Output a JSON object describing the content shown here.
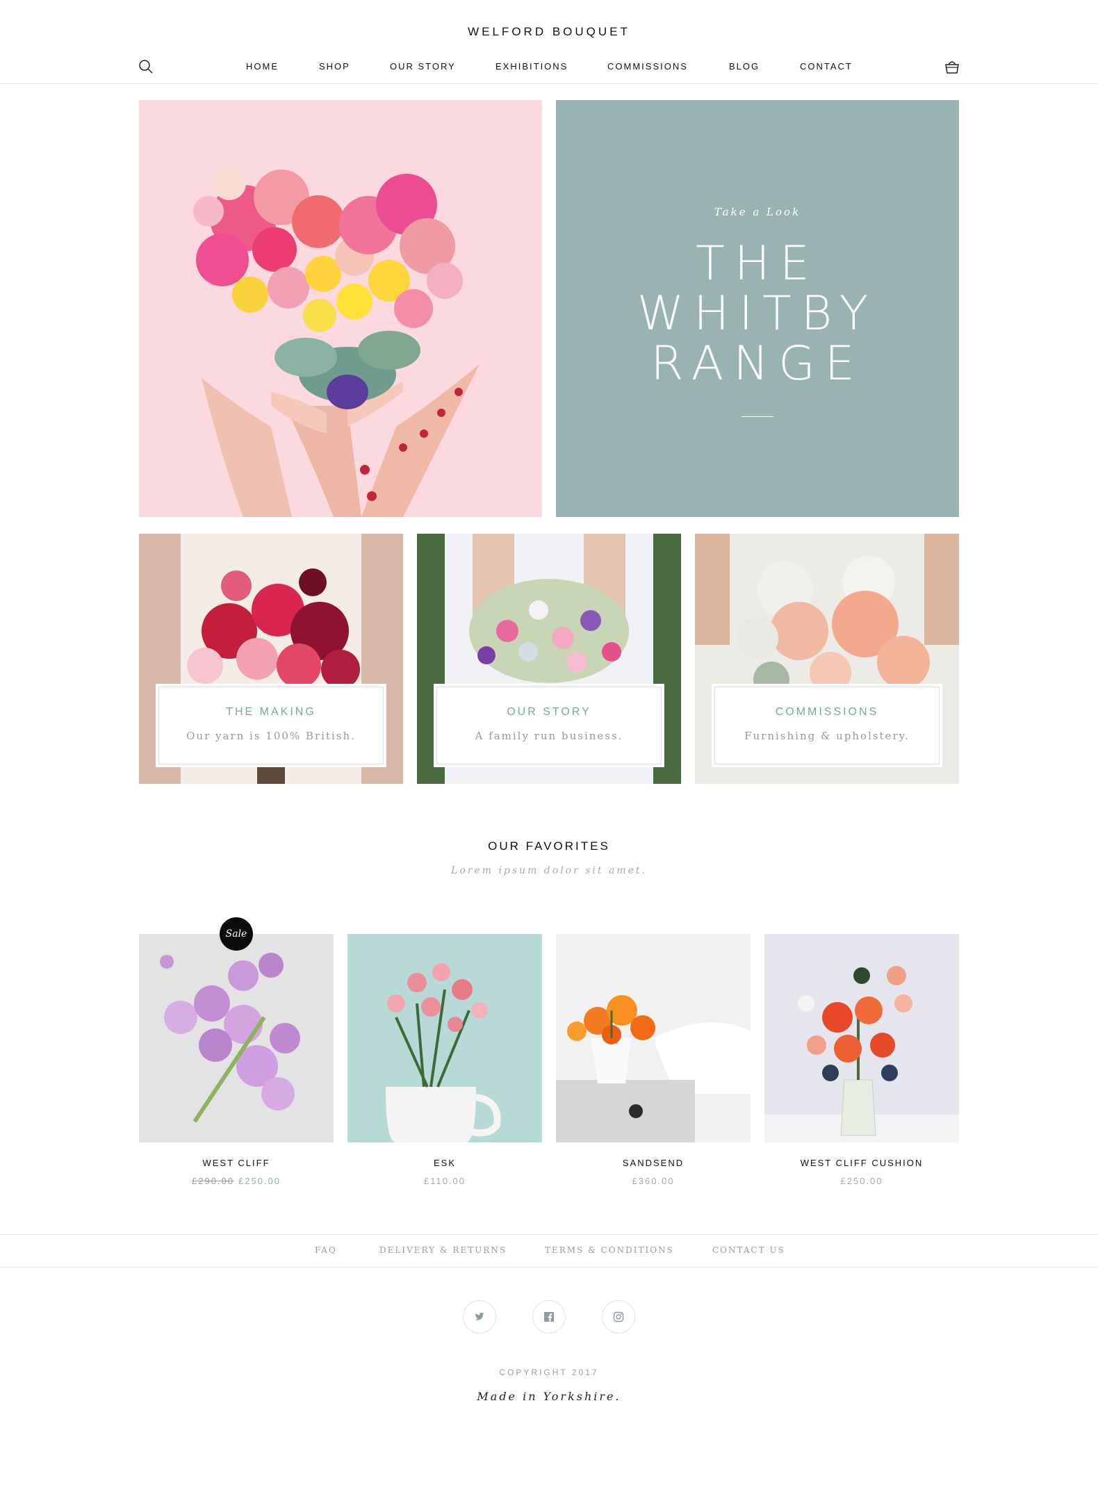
{
  "header": {
    "brand": "WELFORD BOUQUET",
    "search_icon": "search-icon",
    "cart_icon": "basket-icon",
    "nav": [
      {
        "label": "HOME"
      },
      {
        "label": "SHOP"
      },
      {
        "label": "OUR STORY"
      },
      {
        "label": "EXHIBITIONS"
      },
      {
        "label": "COMMISSIONS"
      },
      {
        "label": "BLOG"
      },
      {
        "label": "CONTACT"
      }
    ]
  },
  "hero": {
    "eyebrow": "Take a Look",
    "title_lines": [
      "THE",
      "WHITBY",
      "RANGE"
    ],
    "panel_color": "#98b3b1",
    "image_bg": "#fcd9de"
  },
  "tiles": [
    {
      "title": "THE MAKING",
      "subtitle": "Our yarn is 100% British."
    },
    {
      "title": "OUR STORY",
      "subtitle": "A family run business."
    },
    {
      "title": "COMMISSIONS",
      "subtitle": "Furnishing & upholstery."
    }
  ],
  "favorites": {
    "title": "OUR FAVORITES",
    "subtitle": "Lorem ipsum dolor sit amet.",
    "products": [
      {
        "name": "WEST CLIFF",
        "badge": "Sale",
        "old_price": "£290.00",
        "price": "£250.00"
      },
      {
        "name": "ESK",
        "price": "£110.00"
      },
      {
        "name": "SANDSEND",
        "price": "£360.00"
      },
      {
        "name": "WEST CLIFF CUSHION",
        "price": "£250.00"
      }
    ]
  },
  "footer": {
    "links": [
      {
        "label": "FAQ"
      },
      {
        "label": "DELIVERY & RETURNS"
      },
      {
        "label": "TERMS & CONDITIONS"
      },
      {
        "label": "CONTACT US"
      }
    ],
    "social": [
      "twitter-icon",
      "facebook-icon",
      "instagram-icon"
    ],
    "copyright": "COPYRIGHT 2017",
    "tagline": "Made in Yorkshire."
  },
  "colors": {
    "accent": "#8fb0b2",
    "text": "#111111",
    "muted": "#9b9b9b"
  }
}
